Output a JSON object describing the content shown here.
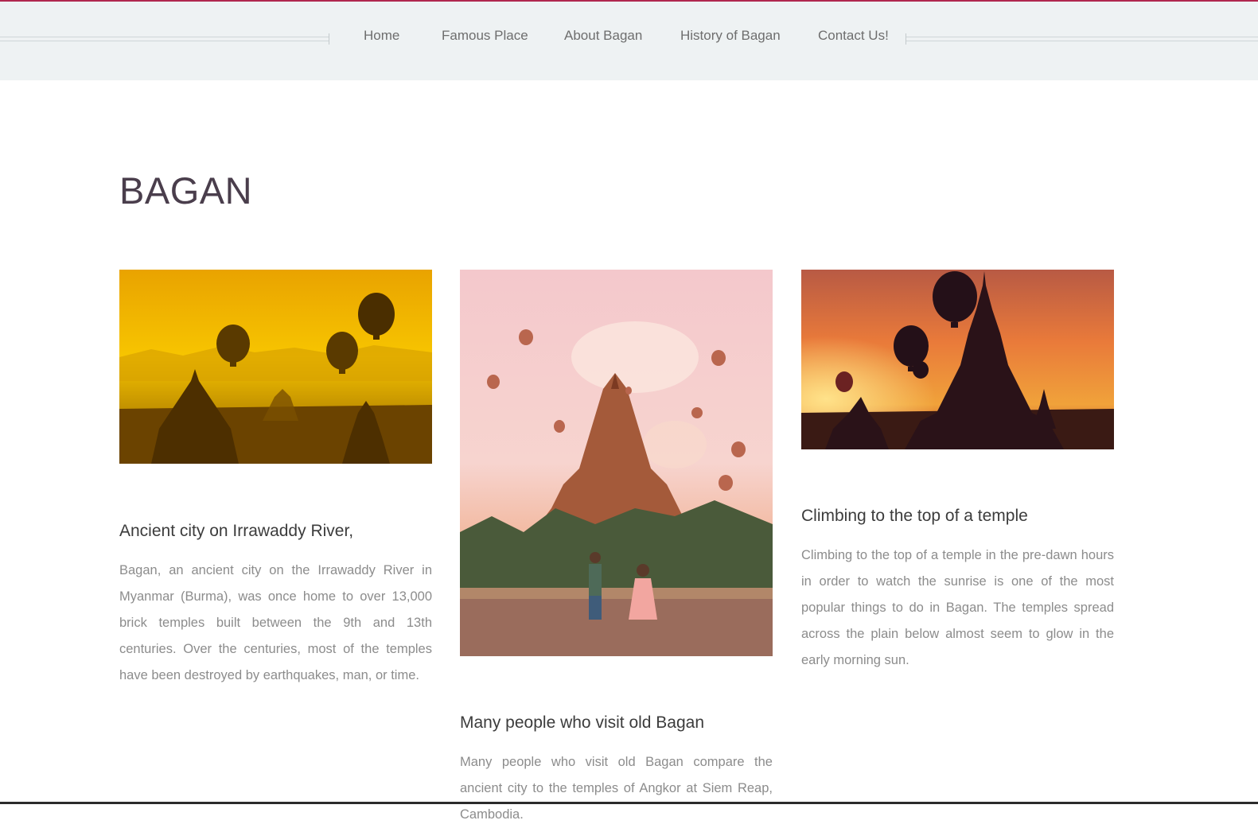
{
  "nav": {
    "items": [
      {
        "label": "Home"
      },
      {
        "label": "Famous Place"
      },
      {
        "label": "About Bagan"
      },
      {
        "label": "History of Bagan"
      },
      {
        "label": "Contact Us!"
      }
    ]
  },
  "page": {
    "title": "BAGAN"
  },
  "cards": [
    {
      "title": "Ancient city on Irrawaddy River,",
      "text": "Bagan, an ancient city on the Irrawaddy River in Myanmar (Burma), was once home to over 13,000 brick temples built between the 9th and 13th centuries. Over the centuries, most of the temples have been destroyed by earthquakes, man, or time."
    },
    {
      "title": "Many people who visit old Bagan",
      "text": "Many people who visit old Bagan compare the ancient city to the temples of Angkor at Siem Reap, Cambodia."
    },
    {
      "title": "Climbing to the top of a temple",
      "text": "Climbing to the top of a temple in the pre-dawn hours in order to watch the sunrise is one of the most popular things to do in Bagan. The temples spread across the plain below almost seem to glow in the early morning sun."
    }
  ],
  "colors": {
    "accent": "#b0284f",
    "header_bg": "#eef2f3",
    "title": "#4a3e4c",
    "body_text": "#8c8c8c"
  }
}
